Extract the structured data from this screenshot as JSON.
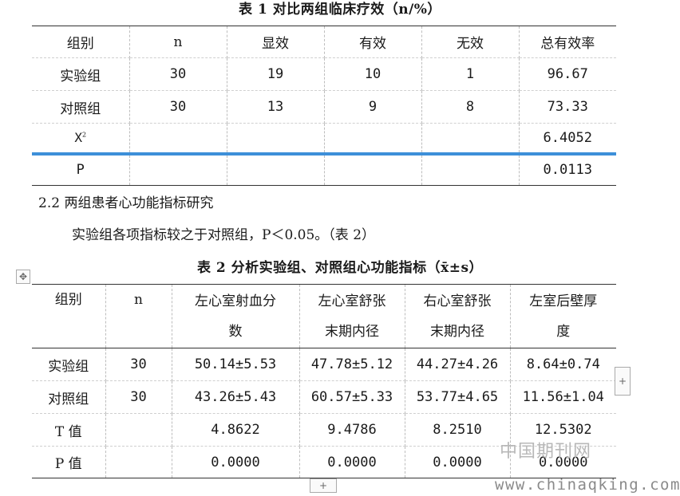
{
  "table1": {
    "caption": "表 1 对比两组临床疗效（n/%）",
    "headers": [
      "组别",
      "n",
      "显效",
      "有效",
      "无效",
      "总有效率"
    ],
    "rows": [
      [
        "实验组",
        "30",
        "19",
        "10",
        "1",
        "96.67"
      ],
      [
        "对照组",
        "30",
        "13",
        "9",
        "8",
        "73.33"
      ]
    ],
    "x2_label_base": "X",
    "x2_label_sup": "2",
    "x2_value": "6.4052",
    "p_label": "P",
    "p_value": "0.0113"
  },
  "section": {
    "heading": "2.2 两组患者心功能指标研究",
    "body": "实验组各项指标较之于对照组，P＜0.05。（表 2）"
  },
  "table2": {
    "caption": "表 2 分析实验组、对照组心功能指标（x̄±s）",
    "headers": [
      {
        "line1": "组别",
        "line2": ""
      },
      {
        "line1": "n",
        "line2": ""
      },
      {
        "line1": "左心室射血分",
        "line2": "数"
      },
      {
        "line1": "左心室舒张",
        "line2": "末期内径"
      },
      {
        "line1": "右心室舒张",
        "line2": "末期内径"
      },
      {
        "line1": "左室后壁厚",
        "line2": "度"
      }
    ],
    "rows": [
      [
        "实验组",
        "30",
        "50.14±5.53",
        "47.78±5.12",
        "44.27±4.26",
        "8.64±0.74"
      ],
      [
        "对照组",
        "30",
        "43.26±5.43",
        "60.57±5.33",
        "53.77±4.65",
        "11.56±1.04"
      ],
      [
        "T 值",
        "",
        "4.8622",
        "9.4786",
        "8.2510",
        "12.5302"
      ],
      [
        "P 值",
        "",
        "0.0000",
        "0.0000",
        "0.0000",
        "0.0000"
      ]
    ]
  },
  "icons": {
    "move_handle": "move-icon",
    "add_column": "plus-icon",
    "add_row": "plus-icon"
  },
  "handles": {
    "add_column_symbol": "+",
    "add_row_symbol": "+",
    "move_symbol": "✥"
  },
  "watermark": {
    "cn": "中国期刊网",
    "url": "www.chinaqking.com"
  }
}
